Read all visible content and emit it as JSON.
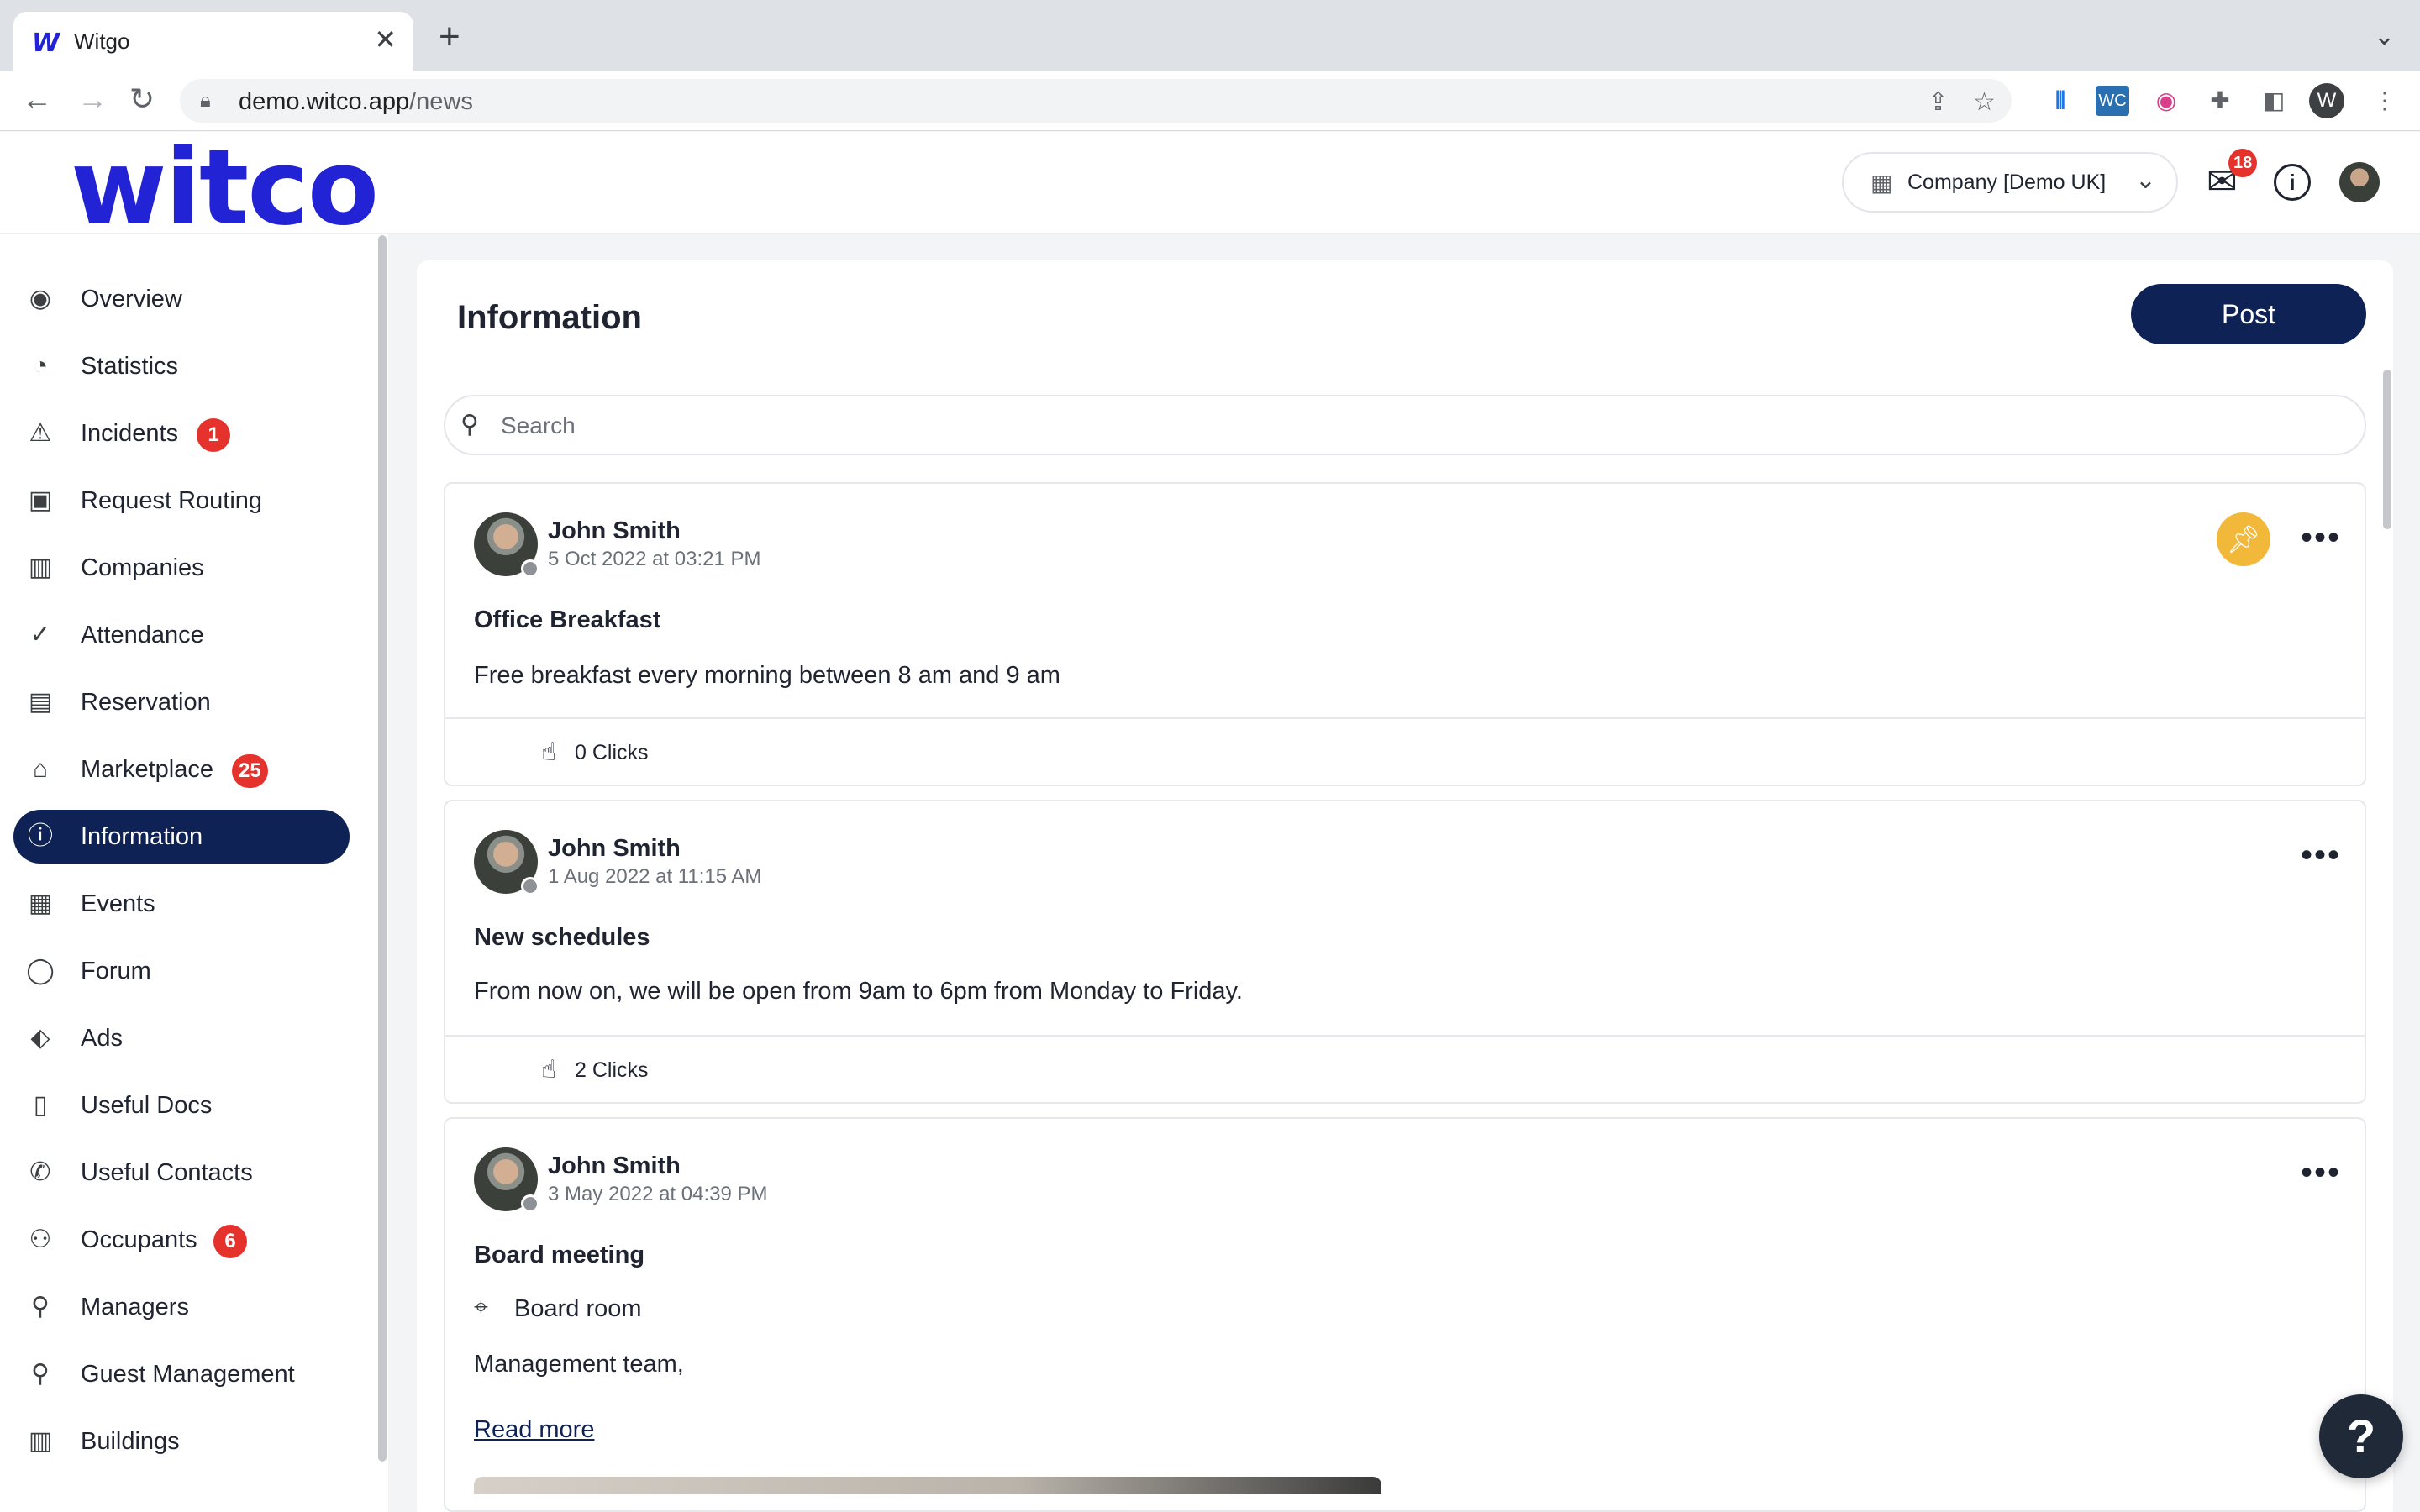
{
  "browser": {
    "tab_title": "Witgo",
    "favicon": "W",
    "url_host": "demo.witco.app",
    "url_path": "/news",
    "profile_initial": "W"
  },
  "header": {
    "logo": "witco",
    "company_select": "Company [Demo UK]",
    "mail_badge": "18"
  },
  "sidebar": {
    "items": [
      {
        "label": "Overview",
        "icon": "eye-icon"
      },
      {
        "label": "Statistics",
        "icon": "pie-chart-icon"
      },
      {
        "label": "Incidents",
        "icon": "warning-icon",
        "badge": "1"
      },
      {
        "label": "Request Routing",
        "icon": "contact-card-icon"
      },
      {
        "label": "Companies",
        "icon": "buildings-icon"
      },
      {
        "label": "Attendance",
        "icon": "check-circle-icon"
      },
      {
        "label": "Reservation",
        "icon": "calendar-icon"
      },
      {
        "label": "Marketplace",
        "icon": "store-icon",
        "badge": "25"
      },
      {
        "label": "Information",
        "icon": "info-icon",
        "active": true
      },
      {
        "label": "Events",
        "icon": "calendar-event-icon"
      },
      {
        "label": "Forum",
        "icon": "chat-bubble-icon"
      },
      {
        "label": "Ads",
        "icon": "tag-icon"
      },
      {
        "label": "Useful Docs",
        "icon": "document-icon"
      },
      {
        "label": "Useful Contacts",
        "icon": "phone-icon"
      },
      {
        "label": "Occupants",
        "icon": "users-icon",
        "badge": "6"
      },
      {
        "label": "Managers",
        "icon": "user-icon"
      },
      {
        "label": "Guest Management",
        "icon": "guest-icon"
      },
      {
        "label": "Buildings",
        "icon": "building-icon"
      }
    ]
  },
  "main": {
    "title": "Information",
    "post_button": "Post",
    "search_placeholder": "Search",
    "posts": [
      {
        "author": "John Smith",
        "date": "5 Oct 2022 at 03:21 PM",
        "title": "Office Breakfast",
        "body": "Free breakfast every morning between 8 am and 9 am",
        "clicks": "0 Clicks",
        "pinned": true
      },
      {
        "author": "John Smith",
        "date": "1 Aug 2022 at 11:15 AM",
        "title": "New schedules",
        "body": "From now on, we will be open from 9am to 6pm from Monday to Friday.",
        "clicks": "2 Clicks",
        "pinned": false
      },
      {
        "author": "John Smith",
        "date": "3 May 2022 at 04:39 PM",
        "title": "Board meeting",
        "location": "Board room",
        "body": "Management team,",
        "read_more": "Read more",
        "pinned": false
      }
    ]
  },
  "help_button": "?",
  "colors": {
    "brand": "#2323d6",
    "nav_active": "#0f2255",
    "badge": "#e5322d",
    "pin": "#f2b83a"
  }
}
